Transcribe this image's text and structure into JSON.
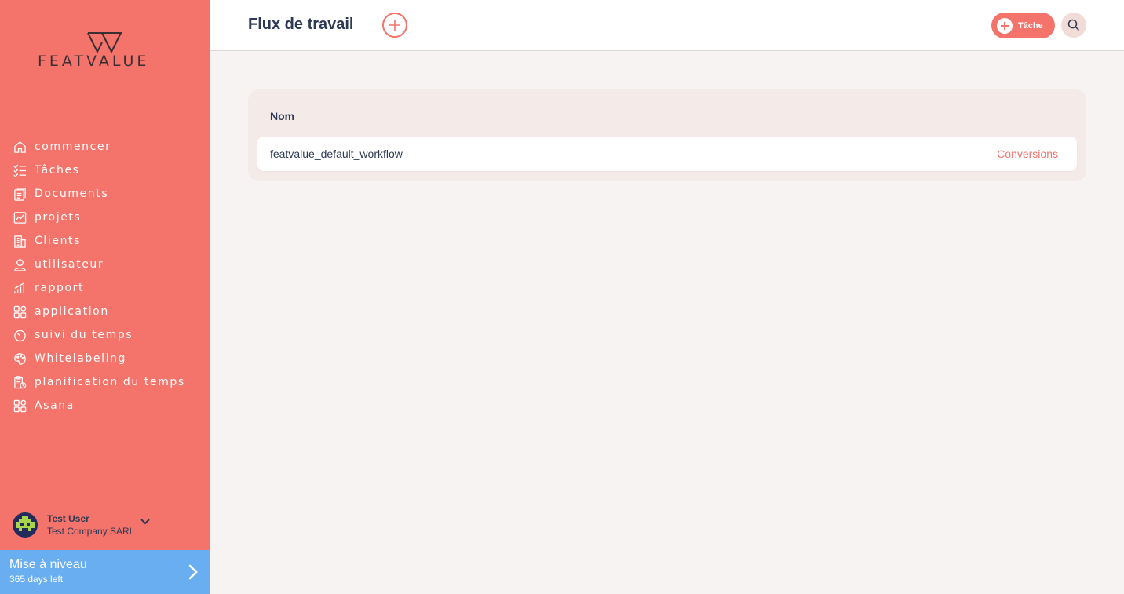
{
  "brand": {
    "name": "FEATVALUE"
  },
  "sidebar": {
    "items": [
      {
        "label": "commencer",
        "icon": "home-icon"
      },
      {
        "label": "Tâches",
        "icon": "checklist-icon"
      },
      {
        "label": "Documents",
        "icon": "document-icon"
      },
      {
        "label": "projets",
        "icon": "chart-icon"
      },
      {
        "label": "Clients",
        "icon": "building-icon"
      },
      {
        "label": "utilisateur",
        "icon": "user-icon"
      },
      {
        "label": "rapport",
        "icon": "bar-chart-icon"
      },
      {
        "label": "application",
        "icon": "apps-icon"
      },
      {
        "label": "suivi du temps",
        "icon": "timer-icon"
      },
      {
        "label": "Whitelabeling",
        "icon": "palette-icon"
      },
      {
        "label": "planification du temps",
        "icon": "clipboard-clock-icon"
      },
      {
        "label": "Asana",
        "icon": "apps-icon"
      }
    ]
  },
  "user": {
    "name": "Test User",
    "company": "Test Company SARL"
  },
  "upgrade": {
    "title": "Mise à niveau",
    "subtitle": "365 days left"
  },
  "header": {
    "title": "Flux de travail",
    "task_button": "Tâche"
  },
  "table": {
    "columns": [
      "Nom"
    ],
    "rows": [
      {
        "name": "featvalue_default_workflow",
        "action": "Conversions"
      }
    ]
  },
  "colors": {
    "primary": "#f4736b",
    "upgrade": "#6aaef2",
    "text": "#2e3a55"
  }
}
